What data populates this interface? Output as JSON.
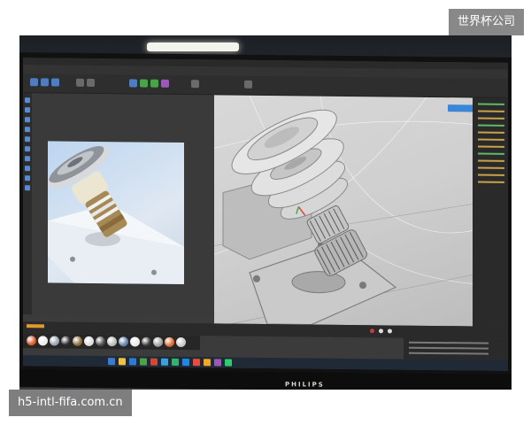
{
  "watermark_top": "世界杯公司",
  "watermark_bottom": "h5-intl-fifa.com.cn",
  "monitor_brand": "PHILIPS",
  "ui_accent_color": "#3a86d8",
  "material_colors": [
    "#d8572a",
    "#ececec",
    "#9aa3ad",
    "#2b2b2b",
    "#8b6a3d",
    "#dcdcdc",
    "#4a4a4a",
    "#b9b9b9",
    "#5e7fa8",
    "#e8e8e8",
    "#333333",
    "#9f9f9f",
    "#d86a2c",
    "#c7c7c7"
  ],
  "taskbar_icon_colors": [
    "#3b7bd4",
    "#f0c040",
    "#2d7ad6",
    "#47a447",
    "#d14836",
    "#3aa0e0",
    "#33b36b",
    "#1e88e5",
    "#e84c3d",
    "#f5a623",
    "#9b59b6",
    "#2ecc71"
  ]
}
